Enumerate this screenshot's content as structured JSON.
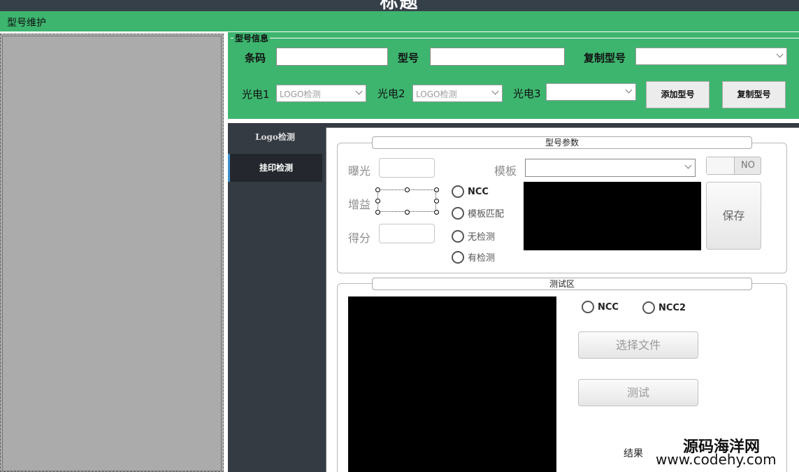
{
  "window": {
    "title": "标题"
  },
  "menu": {
    "item": "型号维护"
  },
  "model_info": {
    "group_title": "型号信息",
    "barcode_label": "条码",
    "model_label": "型号",
    "copy_model_label": "复制型号",
    "sensor1_label": "光电1",
    "sensor2_label": "光电2",
    "sensor3_label": "光电3",
    "sensor1_value": "LOGO检测",
    "sensor2_value": "LOGO检测",
    "sensor3_value": "",
    "add_button": "添加型号",
    "copy_button": "复制型号"
  },
  "nav": {
    "items": [
      {
        "label": "Logo检测",
        "active": false
      },
      {
        "label": "挂印检测",
        "active": true
      }
    ]
  },
  "params": {
    "group_title": "型号参数",
    "exposure_label": "曝光",
    "gain_label": "增益",
    "score_label": "得分",
    "template_label": "模板",
    "radios": [
      "NCC",
      "模板匹配",
      "无检测",
      "有检测"
    ],
    "toggle_text": "NO",
    "save_button": "保存"
  },
  "test": {
    "group_title": "测试区",
    "radios": [
      "NCC",
      "NCC2"
    ],
    "choose_file_button": "选择文件",
    "test_button": "测试",
    "result_label": "结果"
  },
  "watermark": {
    "line1": "源码海洋网",
    "line2": "www.codehy.com"
  },
  "colors": {
    "accent_green": "#3db56f",
    "dark_panel": "#353b43",
    "topbar": "#364049"
  }
}
